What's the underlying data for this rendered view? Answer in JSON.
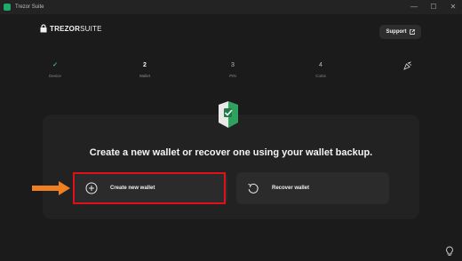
{
  "window": {
    "title": "Trezor Suite",
    "controls": {
      "minimize": "—",
      "maximize": "☐",
      "close": "✕"
    }
  },
  "header": {
    "logo_main": "TREZOR",
    "logo_sub": "SUITE",
    "support_label": "Support",
    "support_icon": "external-link-icon"
  },
  "stepper": {
    "steps": [
      {
        "mark": "✓",
        "label": "Device",
        "state": "done"
      },
      {
        "mark": "2",
        "label": "Wallet",
        "state": "active"
      },
      {
        "mark": "3",
        "label": "PIN",
        "state": "pending"
      },
      {
        "mark": "4",
        "label": "Coins",
        "state": "pending"
      }
    ],
    "final_icon": "party-popper-icon"
  },
  "main": {
    "headline": "Create a new wallet or recover one using your wallet backup.",
    "options": [
      {
        "label": "Create new wallet",
        "icon": "plus-circle-icon"
      },
      {
        "label": "Recover wallet",
        "icon": "restore-icon"
      }
    ]
  },
  "colors": {
    "accent_green": "#3bb873",
    "highlight_red": "#e0111a",
    "arrow_orange": "#f07f22"
  }
}
